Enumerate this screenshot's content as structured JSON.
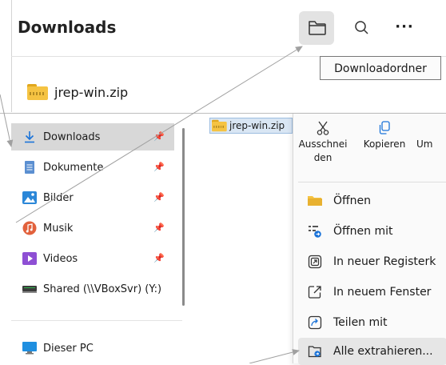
{
  "top": {
    "title": "Downloads",
    "more_label": "···",
    "tooltip": "Downloadordner",
    "file_name": "jrep-win.zip"
  },
  "sidebar": {
    "items": [
      {
        "label": "Downloads",
        "icon": "download-arrow-icon",
        "pinned": true
      },
      {
        "label": "Dokumente",
        "icon": "document-icon",
        "pinned": true
      },
      {
        "label": "Bilder",
        "icon": "pictures-icon",
        "pinned": true
      },
      {
        "label": "Musik",
        "icon": "music-icon",
        "pinned": true
      },
      {
        "label": "Videos",
        "icon": "video-icon",
        "pinned": true
      },
      {
        "label": "Shared (\\\\VBoxSvr) (Y:)",
        "icon": "network-drive-icon",
        "pinned": false
      },
      {
        "label": "Dieser PC",
        "icon": "computer-icon",
        "pinned": false
      }
    ]
  },
  "content": {
    "file_name": "jrep-win.zip"
  },
  "context_menu": {
    "top_actions": [
      {
        "label": "Ausschnei den",
        "icon": "scissors-icon"
      },
      {
        "label": "Kopieren",
        "icon": "copy-icon"
      },
      {
        "label": "Um",
        "icon": "rename-icon"
      }
    ],
    "items": [
      {
        "label": "Öffnen",
        "icon": "folder-open-icon"
      },
      {
        "label": "Öffnen mit",
        "icon": "open-with-icon"
      },
      {
        "label": "In neuer Registerk",
        "icon": "new-tab-icon"
      },
      {
        "label": "In neuem Fenster",
        "icon": "new-window-icon"
      },
      {
        "label": "Teilen mit",
        "icon": "share-icon"
      },
      {
        "label": "Alle extrahieren...",
        "icon": "extract-icon"
      }
    ]
  },
  "colors": {
    "accent": "#1a73d9",
    "selected_bg": "#d8d8d8",
    "folder_yellow": "#f5c342",
    "annotation_line": "#a0a0a0"
  }
}
